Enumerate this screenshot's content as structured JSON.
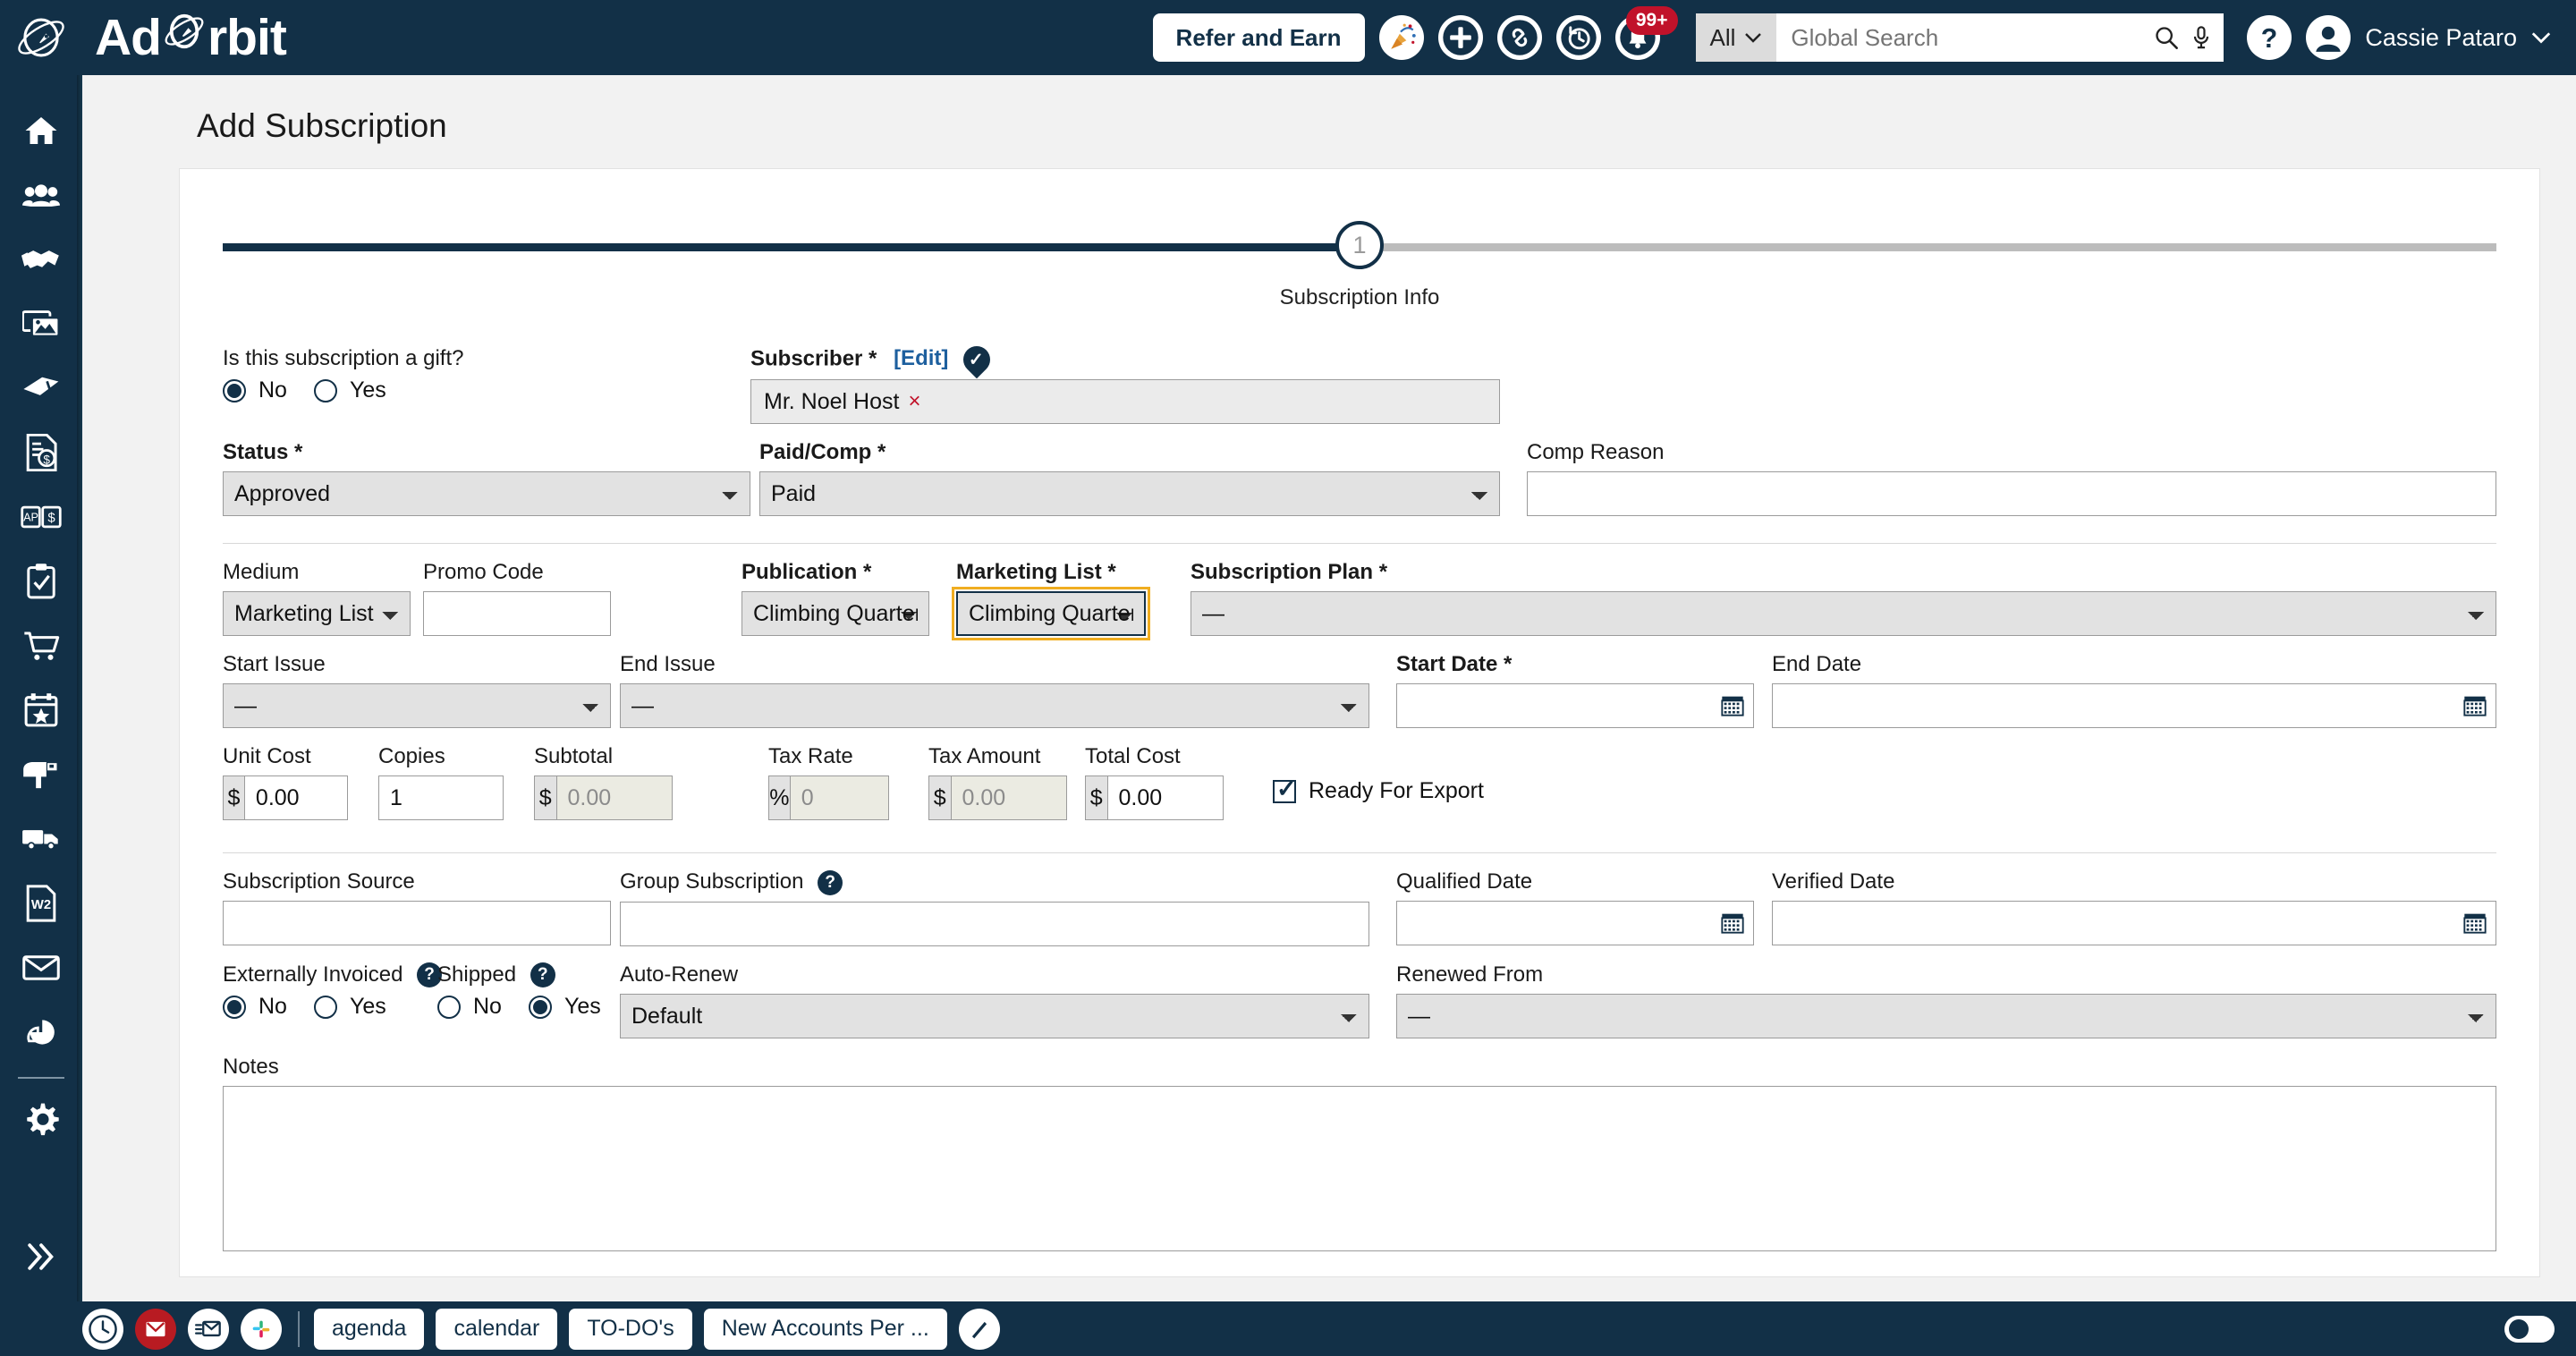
{
  "app": {
    "brand": "AdOrbit",
    "brand_pre": "Ad",
    "brand_post": "rbit",
    "colors": {
      "navy": "#123047",
      "accent_yellow": "#f0ad20",
      "danger": "#c1122a",
      "link": "#1d5f9e"
    }
  },
  "topbar": {
    "refer_label": "Refer and Earn",
    "notification_badge": "99+",
    "search_scope": "All",
    "search_placeholder": "Global Search",
    "search_value": "",
    "user_name": "Cassie Pataro",
    "icons": [
      "party-icon",
      "plus-icon",
      "link-icon",
      "history-icon",
      "bell-icon",
      "help-icon",
      "avatar-icon"
    ]
  },
  "sidebar": {
    "items": [
      {
        "name": "home-icon",
        "label": "Home"
      },
      {
        "name": "people-icon",
        "label": "Contacts"
      },
      {
        "name": "handshake-icon",
        "label": "Deals"
      },
      {
        "name": "images-icon",
        "label": "Media"
      },
      {
        "name": "ticket-icon",
        "label": "Tickets"
      },
      {
        "name": "invoice-icon",
        "label": "Billing"
      },
      {
        "name": "ap-dollar-icon",
        "label": "Accounts Payable"
      },
      {
        "name": "clipboard-check-icon",
        "label": "Tasks"
      },
      {
        "name": "cart-icon",
        "label": "Orders"
      },
      {
        "name": "calendar-star-icon",
        "label": "Events"
      },
      {
        "name": "mailbox-icon",
        "label": "Subscriptions"
      },
      {
        "name": "truck-icon",
        "label": "Distribution"
      },
      {
        "name": "w2-icon",
        "label": "Documents"
      },
      {
        "name": "envelope-icon",
        "label": "Email"
      },
      {
        "name": "pie-chart-icon",
        "label": "Reports"
      },
      {
        "name": "gear-icon",
        "label": "Settings"
      }
    ],
    "collapse_label": "Expand"
  },
  "page": {
    "title": "Add Subscription",
    "stepper": {
      "current": "1",
      "label": "Subscription Info",
      "progress_percent": 50
    }
  },
  "form": {
    "gift": {
      "label": "Is this subscription a gift?",
      "no": "No",
      "yes": "Yes",
      "selected": "No"
    },
    "subscriber": {
      "label": "Subscriber *",
      "edit_link": "[Edit]",
      "value": "Mr. Noel Host",
      "remove": "×"
    },
    "status": {
      "label": "Status *",
      "value": "Approved"
    },
    "paid_comp": {
      "label": "Paid/Comp *",
      "value": "Paid"
    },
    "comp_reason": {
      "label": "Comp Reason",
      "value": ""
    },
    "medium": {
      "label": "Medium",
      "value": "Marketing List"
    },
    "promo_code": {
      "label": "Promo Code",
      "value": ""
    },
    "publication": {
      "label": "Publication *",
      "value": "Climbing Quarterly"
    },
    "marketing_list": {
      "label": "Marketing List *",
      "value": "Climbing Quarterly List",
      "focused": true
    },
    "subscription_plan": {
      "label": "Subscription Plan *",
      "value": "—"
    },
    "start_issue": {
      "label": "Start Issue",
      "value": "—"
    },
    "end_issue": {
      "label": "End Issue",
      "value": "—"
    },
    "start_date": {
      "label": "Start Date *",
      "value": ""
    },
    "end_date": {
      "label": "End Date",
      "value": ""
    },
    "ready_for_export": {
      "label": "Ready For Export",
      "checked": true
    },
    "unit_cost": {
      "label": "Unit Cost",
      "prefix": "$",
      "value": "0.00"
    },
    "copies": {
      "label": "Copies",
      "value": "1"
    },
    "subtotal": {
      "label": "Subtotal",
      "prefix": "$",
      "value": "0.00"
    },
    "tax_rate": {
      "label": "Tax Rate",
      "prefix": "%",
      "value": "0"
    },
    "tax_amount": {
      "label": "Tax Amount",
      "prefix": "$",
      "value": "0.00"
    },
    "total_cost": {
      "label": "Total Cost",
      "prefix": "$",
      "value": "0.00"
    },
    "subscription_source": {
      "label": "Subscription Source",
      "value": ""
    },
    "group_subscription": {
      "label": "Group Subscription",
      "value": "",
      "help": "?"
    },
    "qualified_date": {
      "label": "Qualified Date",
      "value": ""
    },
    "verified_date": {
      "label": "Verified Date",
      "value": ""
    },
    "externally_invoiced": {
      "label": "Externally Invoiced",
      "no": "No",
      "yes": "Yes",
      "selected": "No",
      "help": "?"
    },
    "shipped": {
      "label": "Shipped",
      "no": "No",
      "yes": "Yes",
      "selected": "Yes",
      "help": "?"
    },
    "auto_renew": {
      "label": "Auto-Renew",
      "value": "Default"
    },
    "renewed_from": {
      "label": "Renewed From",
      "value": "—"
    },
    "notes": {
      "label": "Notes",
      "value": ""
    }
  },
  "taskbar": {
    "icons": [
      "clock-icon",
      "mail-unread-icon",
      "mail-read-icon",
      "slack-icon"
    ],
    "tabs": [
      {
        "label": "agenda"
      },
      {
        "label": "calendar"
      },
      {
        "label": "TO-DO's"
      },
      {
        "label": "New Accounts Per ..."
      }
    ],
    "pencil": "pencil-icon",
    "toggle": "chat-toggle"
  }
}
